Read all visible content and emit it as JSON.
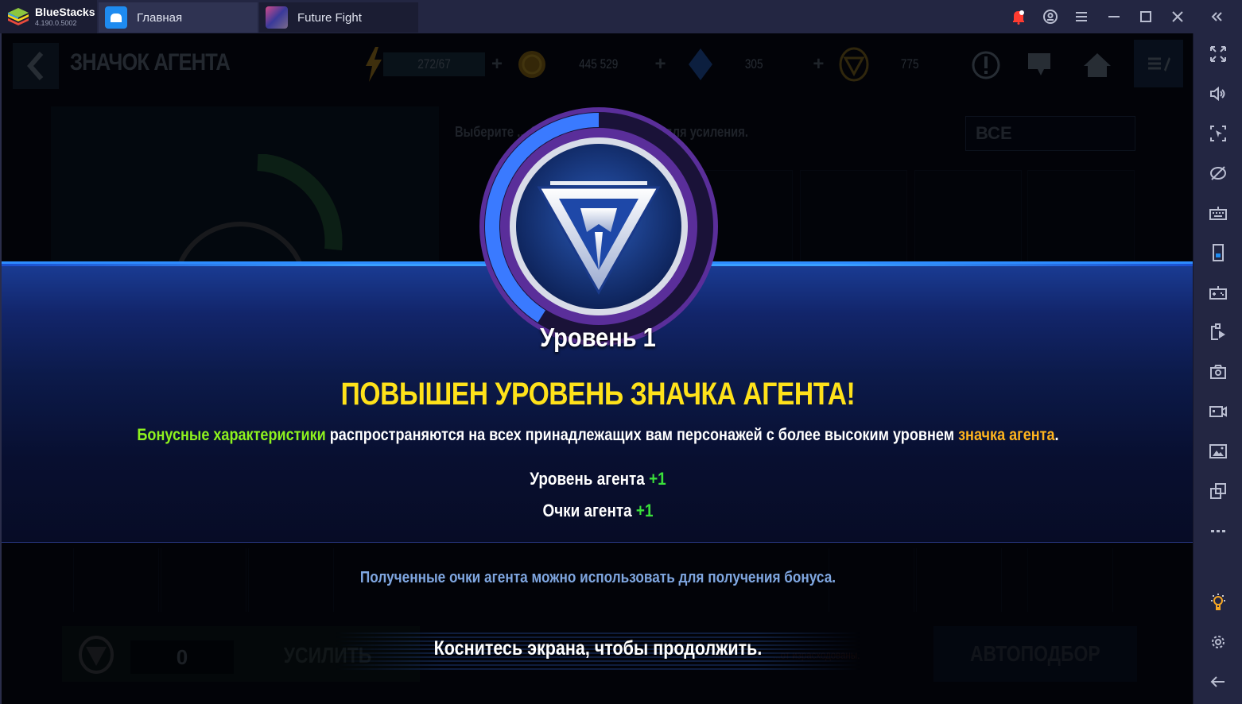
{
  "bluestacks": {
    "brand": "BlueStacks",
    "version": "4.190.0.5002",
    "tabs": [
      {
        "label": "Главная",
        "icon": "home-icon"
      },
      {
        "label": "Future Fight",
        "icon": "game-icon"
      }
    ],
    "window_controls": [
      "bell-icon",
      "account-icon",
      "menu-icon",
      "minimize-icon",
      "maximize-icon",
      "close-icon",
      "collapse-sidebar-icon"
    ],
    "sidebar": [
      "fullscreen-icon",
      "volume-icon",
      "cursor-lock-icon",
      "eye-off-icon",
      "keyboard-icon",
      "phone-icon",
      "gamepad-icon",
      "install-apk-icon",
      "camera-icon",
      "record-icon",
      "media-folder-icon",
      "multi-instance-icon",
      "more-icon",
      "tip-bulb-icon",
      "settings-icon",
      "back-arrow-icon"
    ],
    "accent_colors": {
      "notification": "#ff3b30",
      "bulb": "#f5a623",
      "phone": "#1e8bf0"
    }
  },
  "game": {
    "screen_title": "ЗНАЧОК АГЕНТА",
    "resources": [
      {
        "name": "energy",
        "value": "272/67"
      },
      {
        "name": "gold",
        "value": "445 529"
      },
      {
        "name": "crystals",
        "value": "305"
      },
      {
        "name": "agent-badge-points",
        "value": "775"
      }
    ],
    "select_hint": "Выберите ... будут использоваться для усиления.",
    "filter_value": "ВСЕ",
    "enhance_count": "0",
    "enhance_label": "УСИЛИТЬ",
    "auto_select_label": "АВТОПОДБОР",
    "warning_text": "...от израсходованы."
  },
  "popup": {
    "level_label": "Уровень 1",
    "badge_progress": 0.5,
    "headline": "ПОВЫШЕН УРОВЕНЬ ЗНАЧКА АГЕНТА!",
    "description": {
      "highlight_green": "Бонусные характеристики",
      "middle": " распространяются на всех принадлежащих вам персонажей с более высоким уровнем ",
      "highlight_orange": "значка агента",
      "end": "."
    },
    "stats": [
      {
        "label": "Уровень агента ",
        "value": "+1"
      },
      {
        "label": "Очки агента ",
        "value": "+1"
      }
    ],
    "info": "Полученные очки агента можно использовать для получения бонуса.",
    "continue": "Коснитесь экрана, чтобы продолжить.",
    "colors": {
      "headline": "#ffe21a",
      "green": "#8ef21e",
      "orange": "#ffb41e",
      "plus": "#3ae03a",
      "info": "#7fa6e0"
    }
  }
}
